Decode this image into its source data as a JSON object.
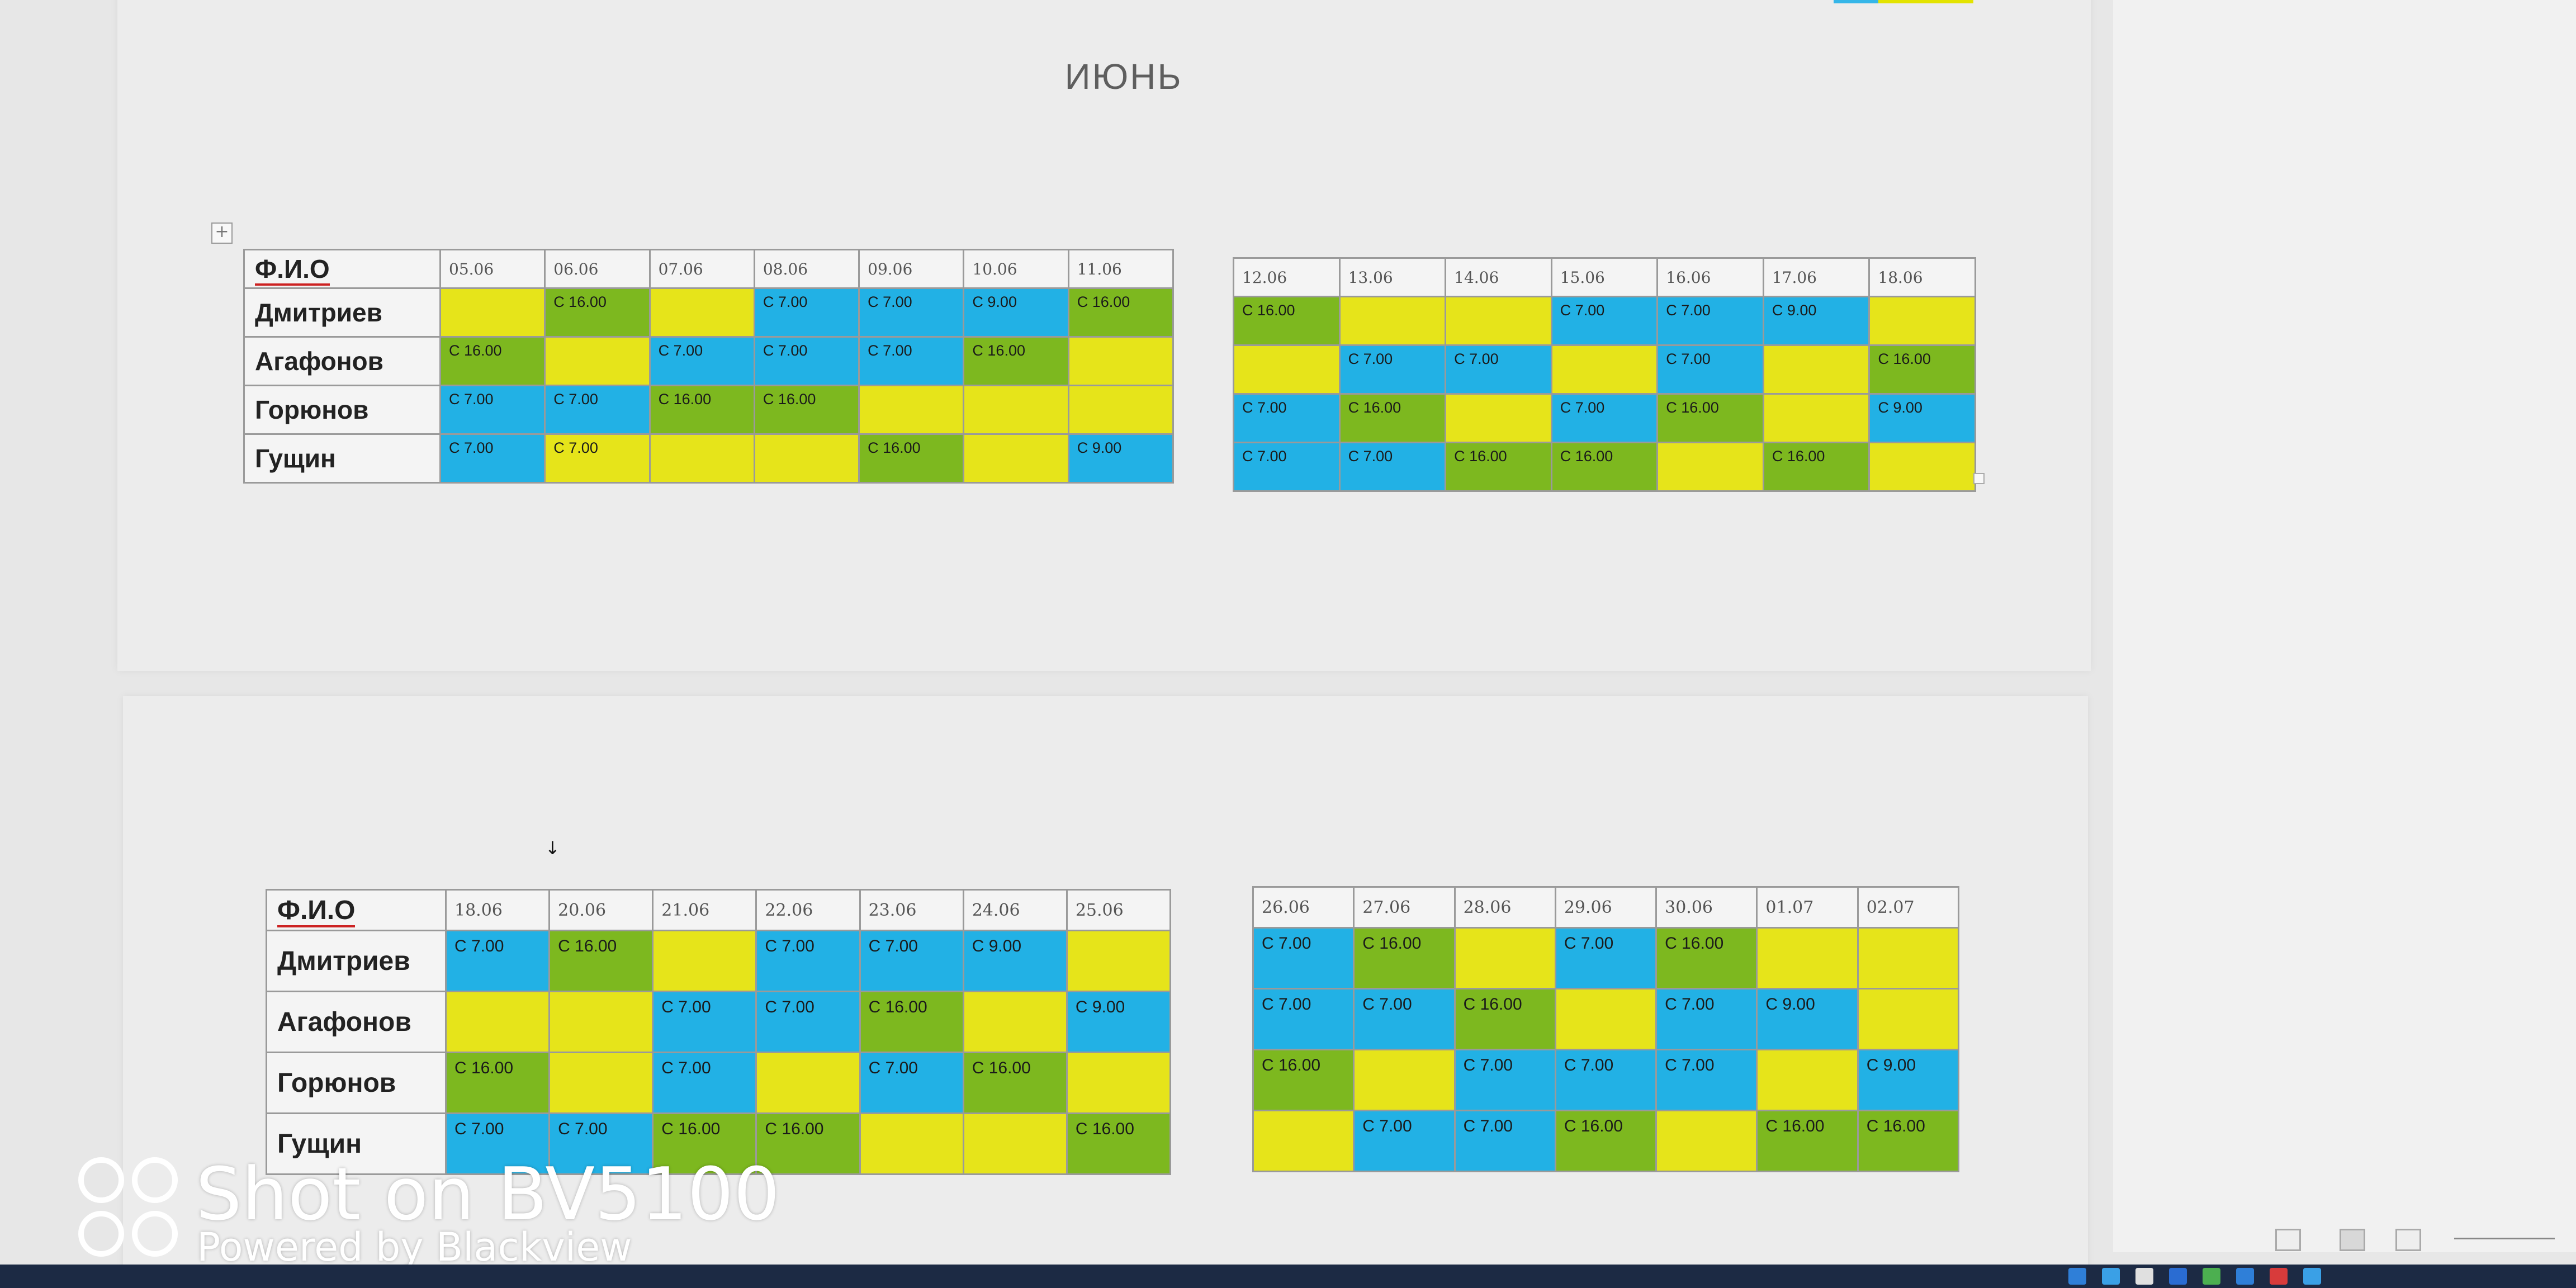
{
  "month_title": "ИЮНЬ",
  "colors": {
    "yellow": "#e6e41a",
    "blue": "#22b1e5",
    "green": "#7db81f"
  },
  "tables": [
    {
      "id": "t1",
      "show_names": true,
      "fio_header": "Ф.И.О",
      "dates": [
        "05.06",
        "06.06",
        "07.06",
        "08.06",
        "09.06",
        "10.06",
        "11.06"
      ],
      "rows": [
        {
          "name": "Дмитриев",
          "cells": [
            {
              "c": "y",
              "t": ""
            },
            {
              "c": "g",
              "t": "С 16.00"
            },
            {
              "c": "y",
              "t": ""
            },
            {
              "c": "b",
              "t": "С 7.00"
            },
            {
              "c": "b",
              "t": "С 7.00"
            },
            {
              "c": "b",
              "t": "С 9.00"
            },
            {
              "c": "g",
              "t": "С 16.00"
            }
          ]
        },
        {
          "name": "Агафонов",
          "cells": [
            {
              "c": "g",
              "t": "С 16.00"
            },
            {
              "c": "y",
              "t": ""
            },
            {
              "c": "b",
              "t": "С 7.00"
            },
            {
              "c": "b",
              "t": "С 7.00"
            },
            {
              "c": "b",
              "t": "С 7.00"
            },
            {
              "c": "g",
              "t": "С 16.00"
            },
            {
              "c": "y",
              "t": ""
            }
          ]
        },
        {
          "name": "Горюнов",
          "cells": [
            {
              "c": "b",
              "t": "С 7.00"
            },
            {
              "c": "b",
              "t": "С 7.00"
            },
            {
              "c": "g",
              "t": "С 16.00"
            },
            {
              "c": "g",
              "t": "С 16.00"
            },
            {
              "c": "y",
              "t": ""
            },
            {
              "c": "y",
              "t": ""
            },
            {
              "c": "y",
              "t": ""
            }
          ]
        },
        {
          "name": "Гущин",
          "cells": [
            {
              "c": "b",
              "t": "С 7.00"
            },
            {
              "c": "y",
              "t": "С 7.00"
            },
            {
              "c": "y",
              "t": ""
            },
            {
              "c": "y",
              "t": ""
            },
            {
              "c": "g",
              "t": "С 16.00"
            },
            {
              "c": "y",
              "t": ""
            },
            {
              "c": "b",
              "t": "С 9.00"
            }
          ]
        }
      ]
    },
    {
      "id": "t2",
      "show_names": false,
      "dates": [
        "12.06",
        "13.06",
        "14.06",
        "15.06",
        "16.06",
        "17.06",
        "18.06"
      ],
      "rows": [
        {
          "cells": [
            {
              "c": "g",
              "t": "С 16.00"
            },
            {
              "c": "y",
              "t": ""
            },
            {
              "c": "y",
              "t": ""
            },
            {
              "c": "b",
              "t": "С 7.00"
            },
            {
              "c": "b",
              "t": "С 7.00"
            },
            {
              "c": "b",
              "t": "С 9.00"
            },
            {
              "c": "y",
              "t": ""
            }
          ]
        },
        {
          "cells": [
            {
              "c": "y",
              "t": ""
            },
            {
              "c": "b",
              "t": "С 7.00"
            },
            {
              "c": "b",
              "t": "С 7.00"
            },
            {
              "c": "y",
              "t": ""
            },
            {
              "c": "b",
              "t": "С 7.00"
            },
            {
              "c": "y",
              "t": ""
            },
            {
              "c": "g",
              "t": "С 16.00"
            }
          ]
        },
        {
          "cells": [
            {
              "c": "b",
              "t": "С 7.00"
            },
            {
              "c": "g",
              "t": "С 16.00"
            },
            {
              "c": "y",
              "t": ""
            },
            {
              "c": "b",
              "t": "С 7.00"
            },
            {
              "c": "g",
              "t": "С 16.00"
            },
            {
              "c": "y",
              "t": ""
            },
            {
              "c": "b",
              "t": "С 9.00"
            }
          ]
        },
        {
          "cells": [
            {
              "c": "b",
              "t": "С 7.00"
            },
            {
              "c": "b",
              "t": "С 7.00"
            },
            {
              "c": "g",
              "t": "С 16.00"
            },
            {
              "c": "g",
              "t": "С 16.00"
            },
            {
              "c": "y",
              "t": ""
            },
            {
              "c": "g",
              "t": "С 16.00"
            },
            {
              "c": "y",
              "t": ""
            }
          ]
        }
      ]
    },
    {
      "id": "t3",
      "show_names": true,
      "fio_header": "Ф.И.О",
      "dates": [
        "18.06",
        "20.06",
        "21.06",
        "22.06",
        "23.06",
        "24.06",
        "25.06"
      ],
      "rows": [
        {
          "name": "Дмитриев",
          "cells": [
            {
              "c": "b",
              "t": "С 7.00"
            },
            {
              "c": "g",
              "t": "С 16.00"
            },
            {
              "c": "y",
              "t": ""
            },
            {
              "c": "b",
              "t": "С 7.00"
            },
            {
              "c": "b",
              "t": "С 7.00"
            },
            {
              "c": "b",
              "t": "С 9.00"
            },
            {
              "c": "y",
              "t": ""
            }
          ]
        },
        {
          "name": "Агафонов",
          "cells": [
            {
              "c": "y",
              "t": ""
            },
            {
              "c": "y",
              "t": ""
            },
            {
              "c": "b",
              "t": "С 7.00"
            },
            {
              "c": "b",
              "t": "С 7.00"
            },
            {
              "c": "g",
              "t": "С 16.00"
            },
            {
              "c": "y",
              "t": ""
            },
            {
              "c": "b",
              "t": "С 9.00"
            }
          ]
        },
        {
          "name": "Горюнов",
          "cells": [
            {
              "c": "g",
              "t": "С 16.00"
            },
            {
              "c": "y",
              "t": ""
            },
            {
              "c": "b",
              "t": "С 7.00"
            },
            {
              "c": "y",
              "t": ""
            },
            {
              "c": "b",
              "t": "С 7.00"
            },
            {
              "c": "g",
              "t": "С 16.00"
            },
            {
              "c": "y",
              "t": ""
            }
          ]
        },
        {
          "name": "Гущин",
          "cells": [
            {
              "c": "b",
              "t": "С 7.00"
            },
            {
              "c": "b",
              "t": "С 7.00"
            },
            {
              "c": "g",
              "t": "С 16.00"
            },
            {
              "c": "g",
              "t": "С 16.00"
            },
            {
              "c": "y",
              "t": ""
            },
            {
              "c": "y",
              "t": ""
            },
            {
              "c": "g",
              "t": "С 16.00"
            }
          ]
        }
      ]
    },
    {
      "id": "t4",
      "show_names": false,
      "dates": [
        "26.06",
        "27.06",
        "28.06",
        "29.06",
        "30.06",
        "01.07",
        "02.07"
      ],
      "rows": [
        {
          "cells": [
            {
              "c": "b",
              "t": "С 7.00"
            },
            {
              "c": "g",
              "t": "С 16.00"
            },
            {
              "c": "y",
              "t": ""
            },
            {
              "c": "b",
              "t": "С 7.00"
            },
            {
              "c": "g",
              "t": "С 16.00"
            },
            {
              "c": "y",
              "t": ""
            },
            {
              "c": "y",
              "t": ""
            }
          ]
        },
        {
          "cells": [
            {
              "c": "b",
              "t": "С 7.00"
            },
            {
              "c": "b",
              "t": "С 7.00"
            },
            {
              "c": "g",
              "t": "С 16.00"
            },
            {
              "c": "y",
              "t": ""
            },
            {
              "c": "b",
              "t": "С 7.00"
            },
            {
              "c": "b",
              "t": "С 9.00"
            },
            {
              "c": "y",
              "t": ""
            }
          ]
        },
        {
          "cells": [
            {
              "c": "g",
              "t": "С 16.00"
            },
            {
              "c": "y",
              "t": ""
            },
            {
              "c": "b",
              "t": "С 7.00"
            },
            {
              "c": "b",
              "t": "С 7.00"
            },
            {
              "c": "b",
              "t": "С 7.00"
            },
            {
              "c": "y",
              "t": ""
            },
            {
              "c": "b",
              "t": "С 9.00"
            }
          ]
        },
        {
          "cells": [
            {
              "c": "y",
              "t": ""
            },
            {
              "c": "b",
              "t": "С 7.00"
            },
            {
              "c": "b",
              "t": "С 7.00"
            },
            {
              "c": "g",
              "t": "С 16.00"
            },
            {
              "c": "y",
              "t": ""
            },
            {
              "c": "g",
              "t": "С 16.00"
            },
            {
              "c": "g",
              "t": "С 16.00"
            }
          ]
        }
      ]
    }
  ],
  "watermark": {
    "title": "Shot on BV5100",
    "subtitle": "Powered by Blackview"
  },
  "icons": {
    "table_move": "move-handle-icon",
    "cursor": "text-cursor-icon"
  }
}
